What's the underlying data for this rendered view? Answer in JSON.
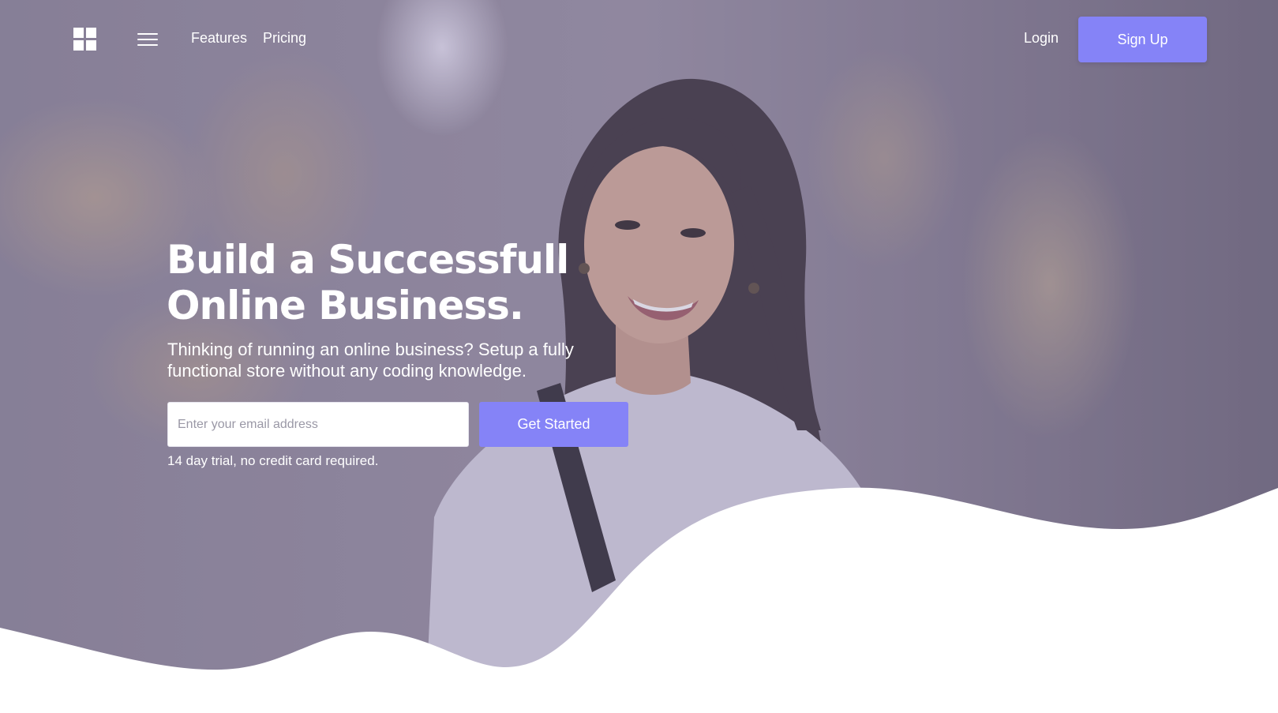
{
  "nav": {
    "logo_icon": "windows-grid-icon",
    "menu_icon": "hamburger-menu-icon",
    "links": [
      {
        "label": "Features"
      },
      {
        "label": "Pricing"
      }
    ],
    "login_label": "Login",
    "signup_label": "Sign Up"
  },
  "hero": {
    "title_line1": "Build a Successfull",
    "title_line2": "Online Business.",
    "subtitle": "Thinking of running an online business? Setup a fully functional store without any coding knowledge.",
    "email_placeholder": "Enter your email address",
    "email_value": "",
    "cta_label": "Get Started",
    "trial_note": "14 day trial, no credit card required."
  },
  "colors": {
    "accent": "#8583f7",
    "overlay": "#8e869c",
    "text_on_hero": "#ffffff",
    "background": "#ffffff"
  }
}
